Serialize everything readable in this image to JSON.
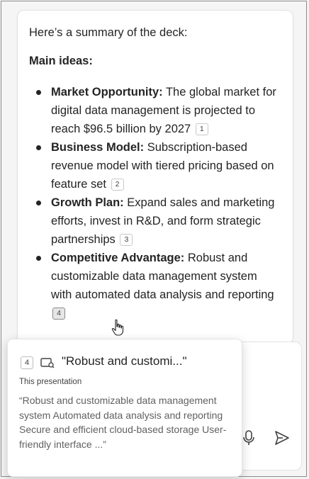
{
  "summary": {
    "intro": "Here’s a summary of the deck:",
    "heading": "Main ideas:",
    "items": [
      {
        "title": "Market Opportunity:",
        "text": " The global market for digital data management is projected to reach $96.5 billion by 2027",
        "cite": "1"
      },
      {
        "title": "Business Model:",
        "text": " Subscription-based revenue model with tiered pricing based on feature set",
        "cite": "2"
      },
      {
        "title": "Growth Plan:",
        "text": " Expand sales and marketing efforts, invest in R&D, and form strategic partnerships",
        "cite": "3"
      },
      {
        "title": "Competitive Advantage:",
        "text": " Robust and customizable data management system with automated data analysis and reporting",
        "cite": "4"
      }
    ]
  },
  "popup": {
    "badge": "4",
    "icon": "presentation-icon",
    "title": "\"Robust and customi...\"",
    "source": "This presentation",
    "quote": "“Robust and customizable data management system Automated data analysis and reporting Secure and efficient cloud-based storage User-friendly interface ...”"
  },
  "composer": {
    "mic_icon": "microphone-icon",
    "send_icon": "send-icon"
  }
}
